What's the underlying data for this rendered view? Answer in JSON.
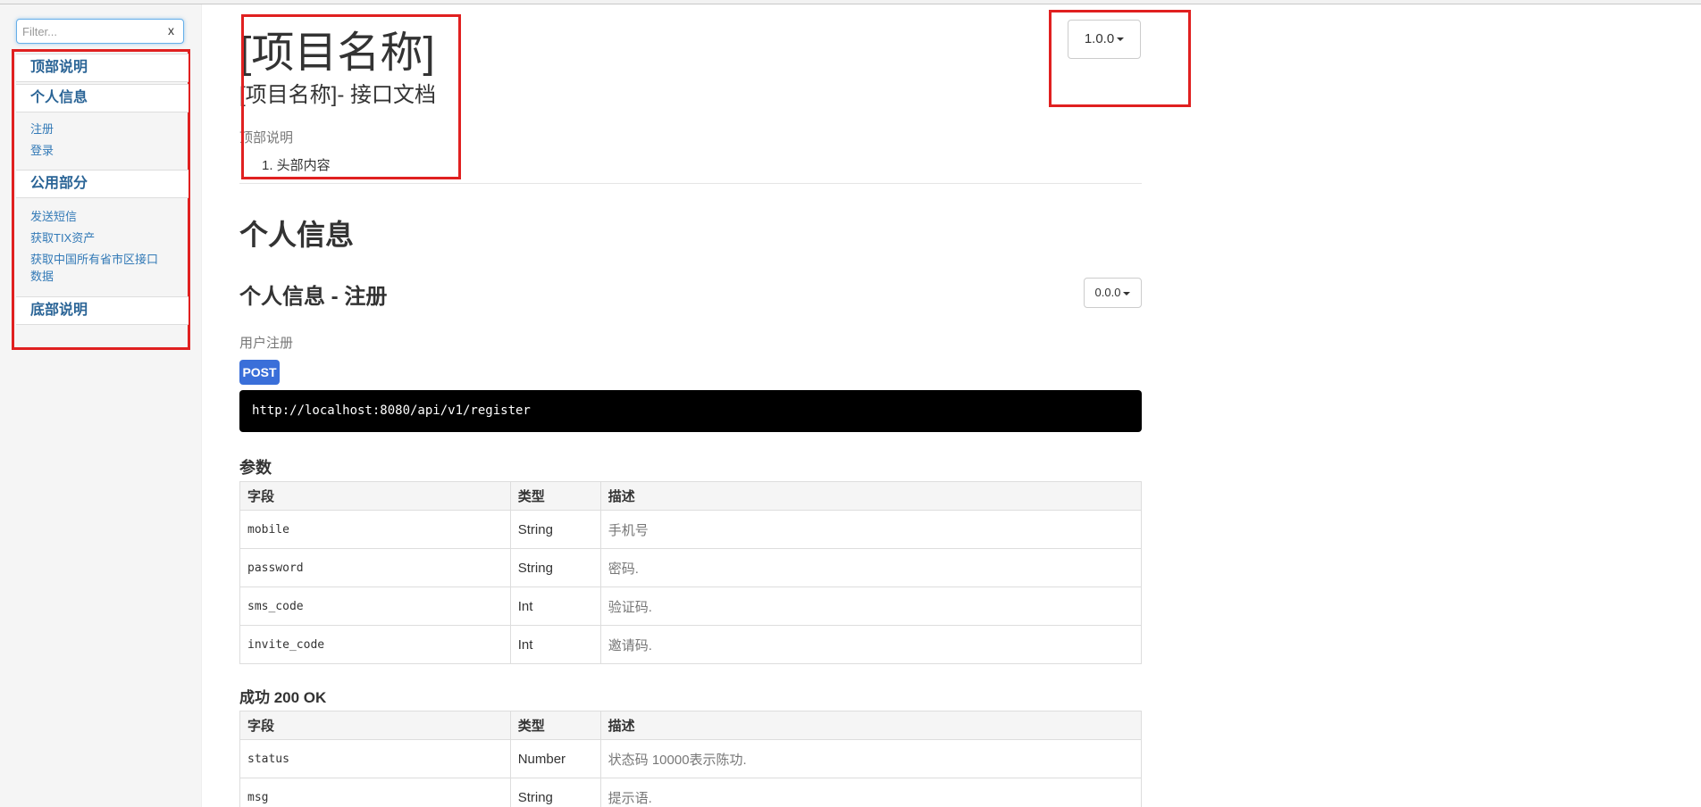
{
  "sidebar": {
    "filter_placeholder": "Filter...",
    "filter_clear": "x",
    "sections": [
      {
        "label": "顶部说明",
        "items": []
      },
      {
        "label": "个人信息",
        "items": [
          "注册",
          "登录"
        ]
      },
      {
        "label": "公用部分",
        "items": [
          "发送短信",
          "获取TIX资产",
          "获取中国所有省市区接口",
          "数据"
        ]
      },
      {
        "label": "底部说明",
        "items": []
      }
    ]
  },
  "header": {
    "title": "[项目名称]",
    "subtitle": "[项目名称]- 接口文档",
    "section_label": "顶部说明",
    "list_item": "1. 头部内容",
    "version": "1.0.0"
  },
  "section": {
    "title": "个人信息",
    "api": {
      "title": "个人信息 - 注册",
      "version": "0.0.0",
      "description": "用户注册",
      "method": "POST",
      "url": "http://localhost:8080/api/v1/register",
      "params_heading": "参数",
      "params": {
        "headers": [
          "字段",
          "类型",
          "描述"
        ],
        "rows": [
          [
            "mobile",
            "String",
            "手机号"
          ],
          [
            "password",
            "String",
            "密码."
          ],
          [
            "sms_code",
            "Int",
            "验证码."
          ],
          [
            "invite_code",
            "Int",
            "邀请码."
          ]
        ]
      },
      "success_heading": "成功 200 OK",
      "success": {
        "headers": [
          "字段",
          "类型",
          "描述"
        ],
        "rows": [
          [
            "status",
            "Number",
            "状态码 10000表示陈功."
          ],
          [
            "msg",
            "String",
            "提示语."
          ]
        ]
      }
    }
  },
  "colors": {
    "highlight_box": "#e02020",
    "link": "#337ab7",
    "method_badge": "#3a6fd9"
  }
}
